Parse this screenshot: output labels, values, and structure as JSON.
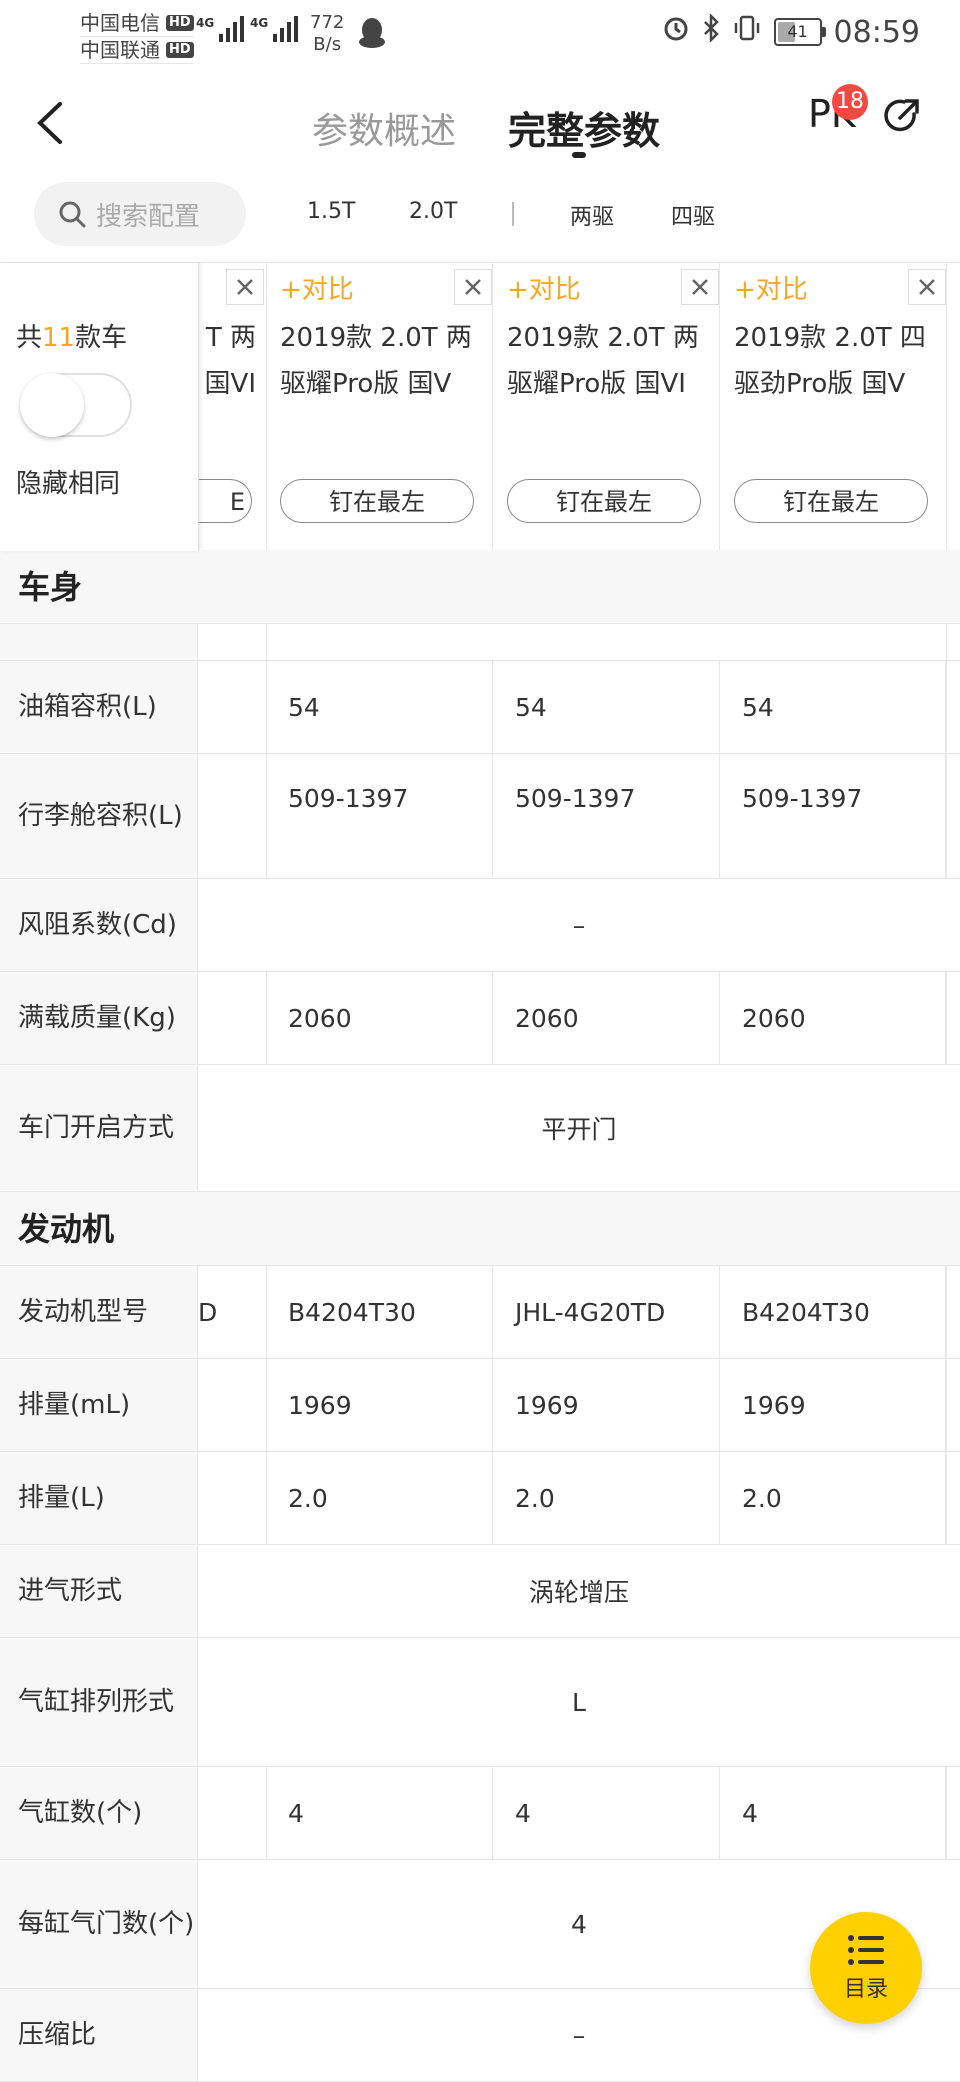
{
  "status_bar": {
    "carrier1": "中国电信",
    "carrier2": "中国联通",
    "hd": "HD",
    "net_type": "4G",
    "speed_value": "772",
    "speed_unit": "B/s",
    "battery": "41",
    "time": "08:59"
  },
  "nav": {
    "tab_overview": "参数概述",
    "tab_full": "完整参数",
    "pk_label": "PK",
    "pk_badge": "18"
  },
  "filter": {
    "search_placeholder": "搜索配置",
    "options": [
      "1.5T",
      "2.0T",
      "两驱",
      "四驱"
    ]
  },
  "left_panel": {
    "count_prefix": "共",
    "count_number": "11",
    "count_suffix": "款车",
    "hide_same_label": "隐藏相同"
  },
  "cars": [
    {
      "compare_label": "+对比",
      "name": "2019款 2.0T 两驱耀Pro版 国V",
      "pin_label": "钉在最左"
    },
    {
      "compare_label": "+对比",
      "name": "2019款 2.0T 两驱耀Pro版 国VI",
      "pin_label": "钉在最左"
    },
    {
      "compare_label": "+对比",
      "name": "2019款 2.0T 四驱劲Pro版 国V",
      "pin_label": "钉在最左"
    }
  ],
  "partial_car": {
    "name_fragment_1": "T 两",
    "name_fragment_2": "国VI",
    "pin_fragment": "E"
  },
  "sections": [
    {
      "title": "车身",
      "rows": [
        {
          "label": "油箱容积(L)",
          "values": [
            "54",
            "54",
            "54"
          ]
        },
        {
          "label": "行李舱容积(L)",
          "values": [
            "509-1397",
            "509-1397",
            "509-1397"
          ]
        },
        {
          "label": "风阻系数(Cd)",
          "merged": "–"
        },
        {
          "label": "满载质量(Kg)",
          "values": [
            "2060",
            "2060",
            "2060"
          ]
        },
        {
          "label": "车门开启方式",
          "merged": "平开门"
        }
      ]
    },
    {
      "title": "发动机",
      "rows": [
        {
          "label": "发动机型号",
          "partial": "D",
          "values": [
            "B4204T30",
            "JHL-4G20TD",
            "B4204T30"
          ]
        },
        {
          "label": "排量(mL)",
          "values": [
            "1969",
            "1969",
            "1969"
          ]
        },
        {
          "label": "排量(L)",
          "values": [
            "2.0",
            "2.0",
            "2.0"
          ]
        },
        {
          "label": "进气形式",
          "merged": "涡轮增压"
        },
        {
          "label": "气缸排列形式",
          "merged": "L"
        },
        {
          "label": "气缸数(个)",
          "values": [
            "4",
            "4",
            "4"
          ]
        },
        {
          "label": "每缸气门数(个)",
          "merged": "4"
        },
        {
          "label": "压缩比",
          "merged": "–"
        }
      ]
    }
  ],
  "fab": {
    "label": "目录",
    "icon": "list-icon"
  },
  "colors": {
    "accent": "#f5a623",
    "fab": "#ffd000",
    "badge": "#f24a43"
  }
}
